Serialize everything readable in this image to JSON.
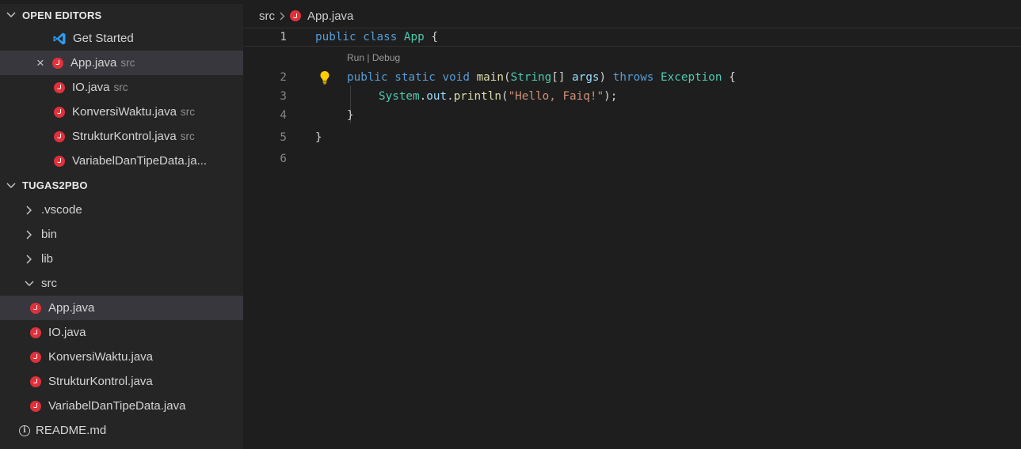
{
  "open_editors": {
    "title": "OPEN EDITORS",
    "items": [
      {
        "label": "Get Started",
        "desc": "",
        "icon": "vscode-icon"
      },
      {
        "label": "App.java",
        "desc": "src",
        "icon": "java-icon"
      },
      {
        "label": "IO.java",
        "desc": "src",
        "icon": "java-icon"
      },
      {
        "label": "KonversiWaktu.java",
        "desc": "src",
        "icon": "java-icon"
      },
      {
        "label": "StrukturKontrol.java",
        "desc": "src",
        "icon": "java-icon"
      },
      {
        "label": "VariabelDanTipeData.ja...",
        "desc": "",
        "icon": "java-icon"
      }
    ]
  },
  "explorer": {
    "title": "TUGAS2PBO",
    "folders": [
      {
        "label": ".vscode",
        "state": "collapsed"
      },
      {
        "label": "bin",
        "state": "collapsed"
      },
      {
        "label": "lib",
        "state": "collapsed"
      },
      {
        "label": "src",
        "state": "expanded"
      }
    ],
    "src_files": [
      "App.java",
      "IO.java",
      "KonversiWaktu.java",
      "StrukturKontrol.java",
      "VariabelDanTipeData.java"
    ],
    "readme": "README.md"
  },
  "breadcrumb": {
    "folder": "src",
    "file": "App.java"
  },
  "editor": {
    "codelens": {
      "run": "Run",
      "sep": " | ",
      "debug": "Debug"
    },
    "line_numbers": [
      "1",
      "2",
      "3",
      "4",
      "5",
      "6"
    ],
    "line1": {
      "t1": "public",
      "t2": " ",
      "t3": "class",
      "t4": " ",
      "t5": "App",
      "t6": " {"
    },
    "line2": {
      "t1": "public",
      "t2": " ",
      "t3": "static",
      "t4": " ",
      "t5": "void",
      "t6": " ",
      "t7": "main",
      "t8": "(",
      "t9": "String",
      "t10": "[] ",
      "t11": "args",
      "t12": ") ",
      "t13": "throws",
      "t14": " ",
      "t15": "Exception",
      "t16": " {"
    },
    "line3": {
      "t1": "System",
      "t2": ".",
      "t3": "out",
      "t4": ".",
      "t5": "println",
      "t6": "(",
      "t7": "\"Hello, Faiq!\"",
      "t8": ");"
    },
    "line4": {
      "t1": "}"
    },
    "line5": {
      "t1": "}"
    }
  },
  "colors": {
    "keyword": "#569cd6",
    "type": "#4ec9b0",
    "function": "#dcdcaa",
    "variable": "#9cdcfe",
    "string": "#ce9178",
    "java_icon": "#e0313b",
    "selection": "#37373d"
  }
}
